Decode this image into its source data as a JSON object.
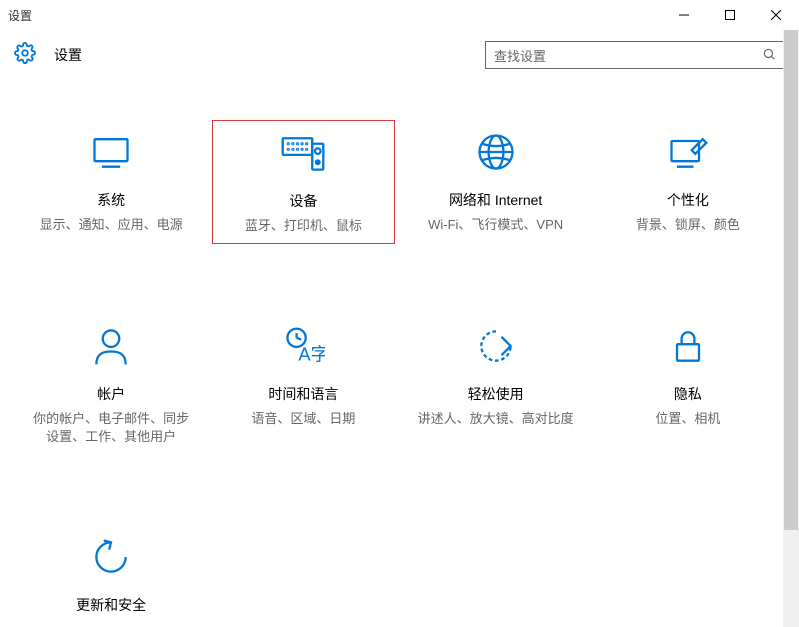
{
  "window_title": "设置",
  "header_title": "设置",
  "search_placeholder": "查找设置",
  "highlighted_index": 1,
  "colors": {
    "accent": "#0078d7",
    "highlight_border": "#d83b3b"
  },
  "tiles": [
    {
      "id": "system",
      "title": "系统",
      "desc": "显示、通知、应用、电源"
    },
    {
      "id": "devices",
      "title": "设备",
      "desc": "蓝牙、打印机、鼠标"
    },
    {
      "id": "network",
      "title": "网络和 Internet",
      "desc": "Wi-Fi、飞行模式、VPN"
    },
    {
      "id": "personal",
      "title": "个性化",
      "desc": "背景、锁屏、颜色"
    },
    {
      "id": "accounts",
      "title": "帐户",
      "desc": "你的帐户、电子邮件、同步设置、工作、其他用户"
    },
    {
      "id": "timelang",
      "title": "时间和语言",
      "desc": "语音、区域、日期"
    },
    {
      "id": "ease",
      "title": "轻松使用",
      "desc": "讲述人、放大镜、高对比度"
    },
    {
      "id": "privacy",
      "title": "隐私",
      "desc": "位置、相机"
    },
    {
      "id": "update",
      "title": "更新和安全",
      "desc": ""
    }
  ]
}
